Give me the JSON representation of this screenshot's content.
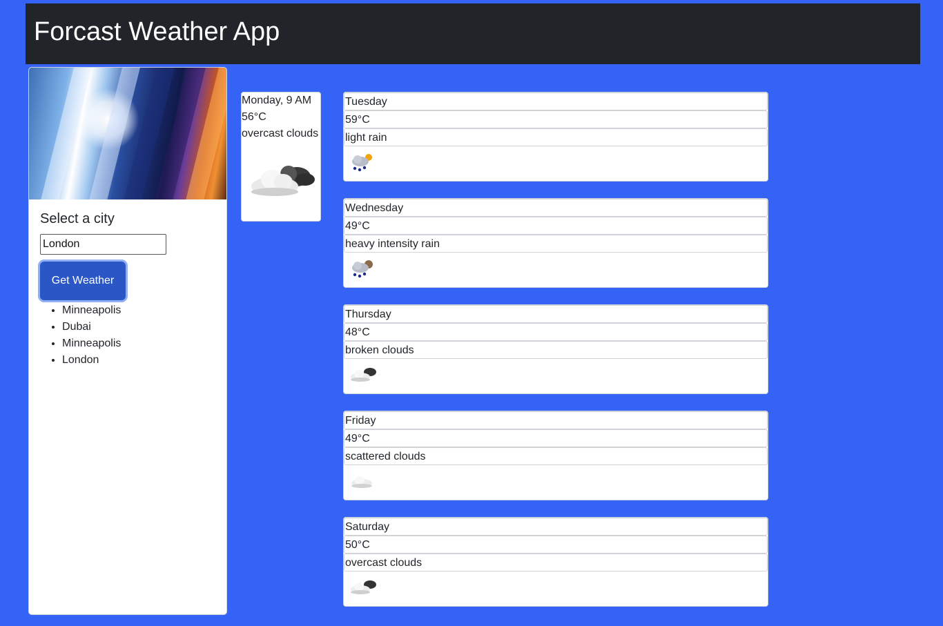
{
  "header": {
    "title": "Forcast Weather App"
  },
  "sidebar": {
    "title": "Select a city",
    "input_value": "London",
    "button_label": "Get Weather",
    "history": [
      "Minneapolis",
      "Dubai",
      "Minneapolis",
      "London"
    ]
  },
  "current": {
    "datetime": "Monday, 9 AM",
    "temp": "56°C",
    "description": "overcast clouds",
    "icon": "overcast-clouds-icon"
  },
  "forecast": [
    {
      "day": "Tuesday",
      "temp": "59°C",
      "description": "light rain",
      "icon": "light-rain-icon"
    },
    {
      "day": "Wednesday",
      "temp": "49°C",
      "description": "heavy intensity rain",
      "icon": "heavy-rain-icon"
    },
    {
      "day": "Thursday",
      "temp": "48°C",
      "description": "broken clouds",
      "icon": "broken-clouds-icon"
    },
    {
      "day": "Friday",
      "temp": "49°C",
      "description": "scattered clouds",
      "icon": "scattered-clouds-icon"
    },
    {
      "day": "Saturday",
      "temp": "50°C",
      "description": "overcast clouds",
      "icon": "overcast-clouds-icon"
    }
  ],
  "colors": {
    "page_bg": "#3563f6",
    "navbar_bg": "#212529",
    "button_bg": "#2b57c6"
  }
}
